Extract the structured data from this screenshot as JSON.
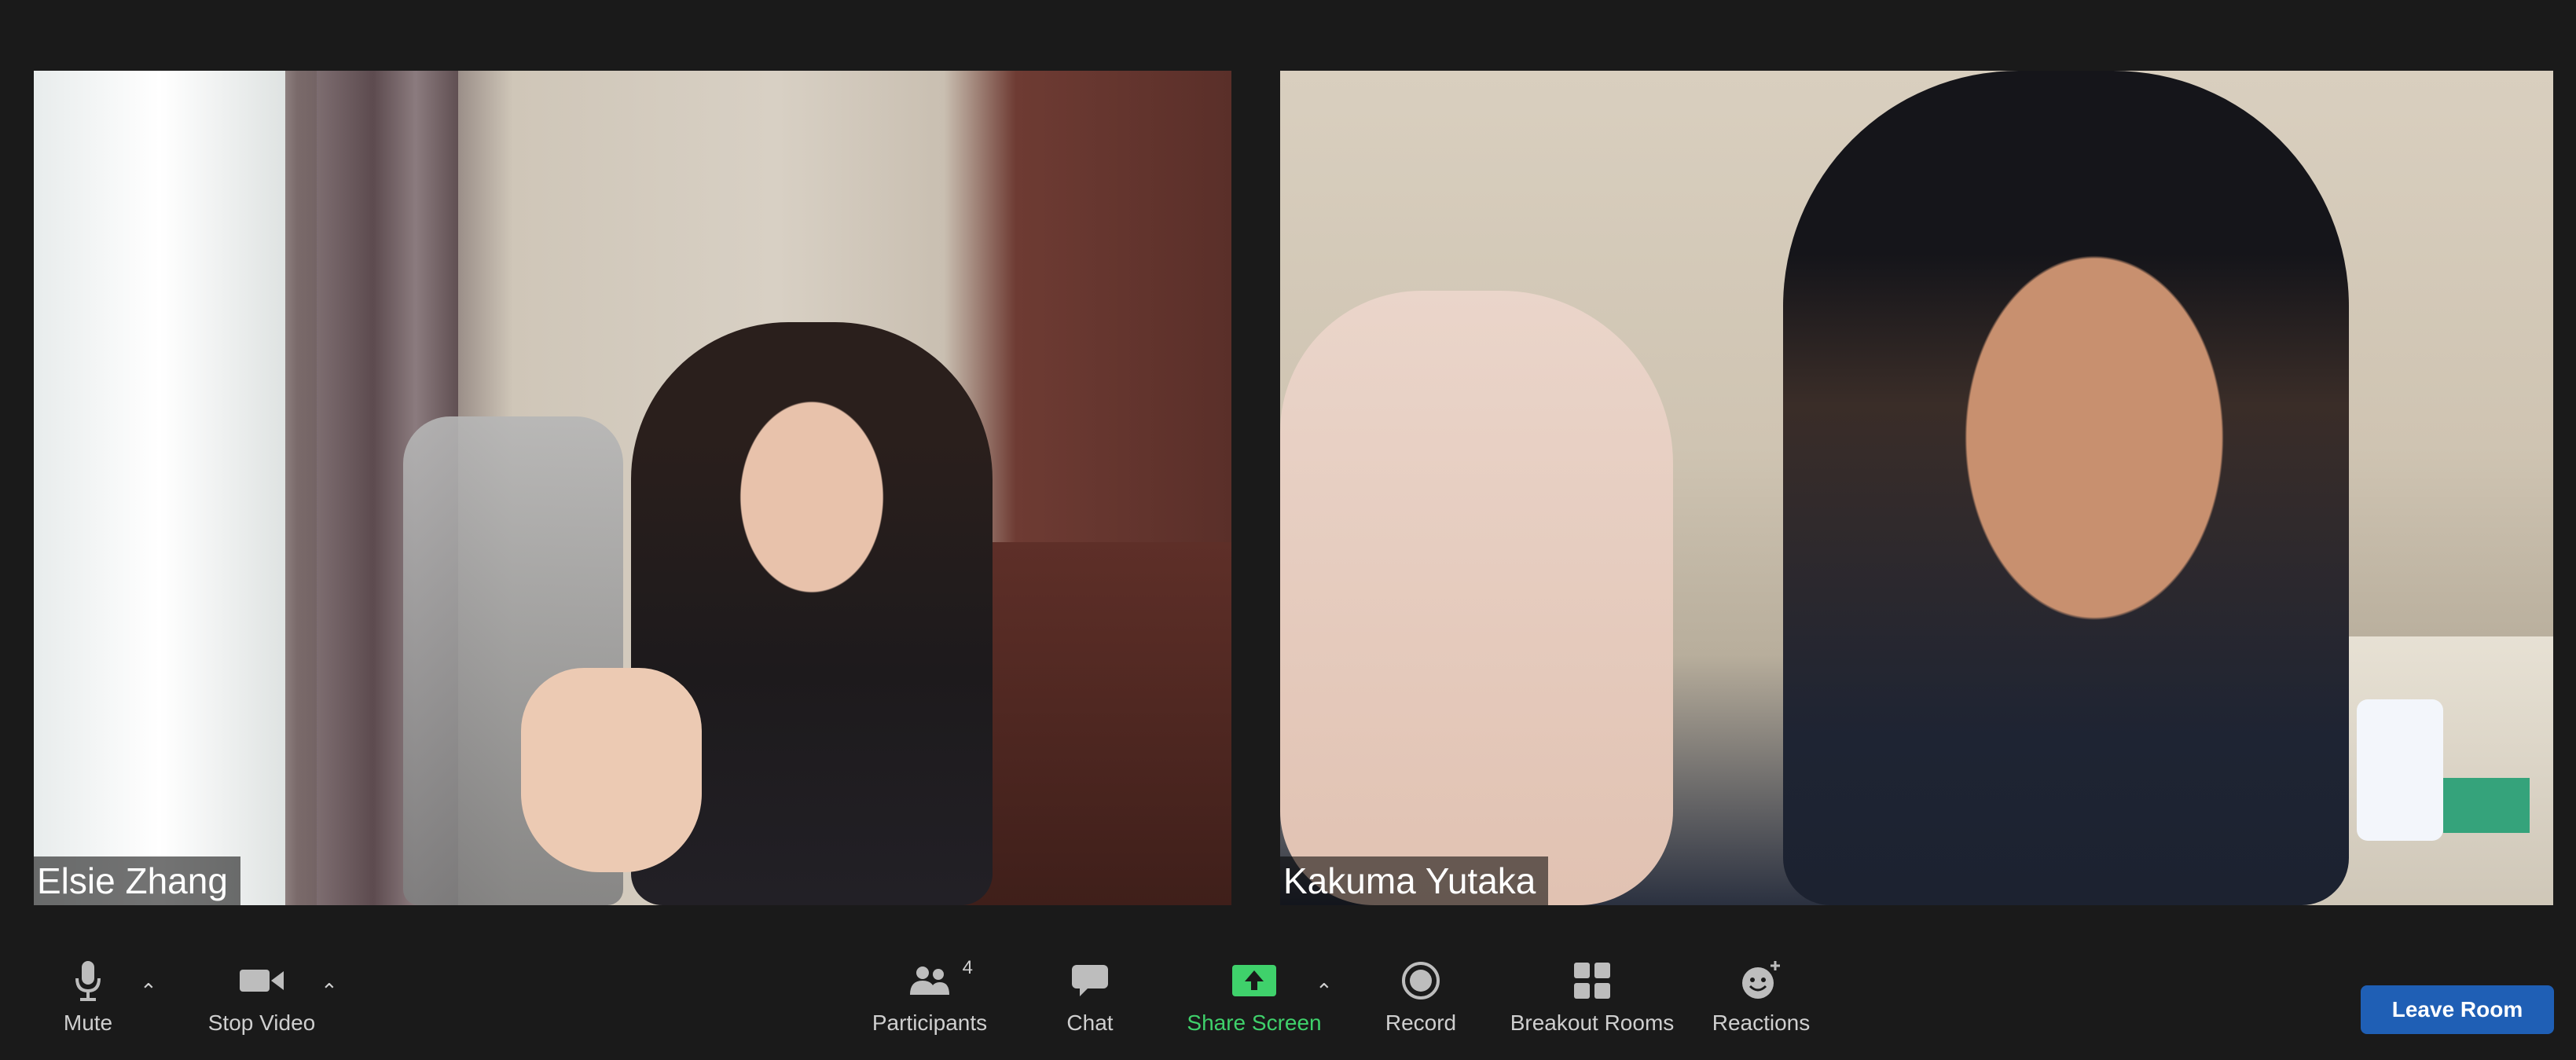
{
  "participants": [
    {
      "name": "Elsie Zhang"
    },
    {
      "name": "Kakuma Yutaka"
    }
  ],
  "toolbar": {
    "mute": {
      "label": "Mute",
      "icon": "microphone-icon"
    },
    "stop_video": {
      "label": "Stop Video",
      "icon": "video-camera-icon"
    },
    "participants": {
      "label": "Participants",
      "icon": "people-icon",
      "count": "4"
    },
    "chat": {
      "label": "Chat",
      "icon": "chat-bubble-icon"
    },
    "share_screen": {
      "label": "Share Screen",
      "icon": "share-screen-icon"
    },
    "record": {
      "label": "Record",
      "icon": "record-icon"
    },
    "breakout_rooms": {
      "label": "Breakout Rooms",
      "icon": "breakout-rooms-icon"
    },
    "reactions": {
      "label": "Reactions",
      "icon": "reactions-icon"
    },
    "leave": {
      "label": "Leave Room"
    }
  },
  "colors": {
    "background": "#1a1a1a",
    "share_green": "#3fd16b",
    "leave_blue": "#1f5fb5"
  }
}
